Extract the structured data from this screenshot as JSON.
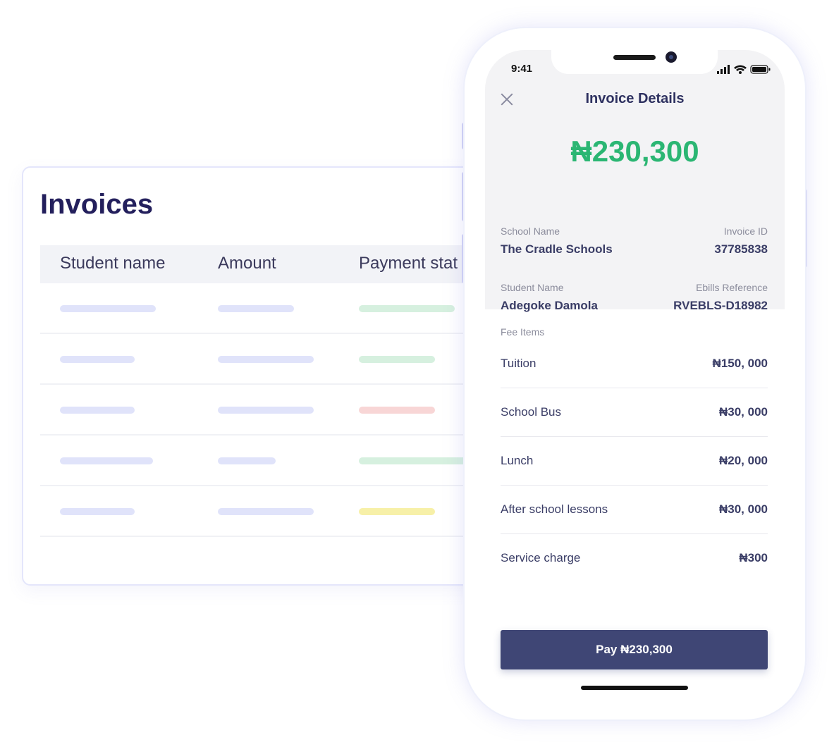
{
  "invoices": {
    "title": "Invoices",
    "columns": [
      "Student name",
      "Amount",
      "Payment stat"
    ],
    "row_status_colors": [
      "#d6f0df",
      "#d6f0df",
      "#f8d6d6",
      "#d6f0df",
      "#f7f0a8"
    ],
    "placeholder_color": "#e0e3fa"
  },
  "phone": {
    "status_time": "9:41",
    "title": "Invoice Details",
    "total": "₦230,300",
    "school_name_label": "School Name",
    "school_name": "The Cradle Schools",
    "invoice_id_label": "Invoice ID",
    "invoice_id": "37785838",
    "student_name_label": "Student Name",
    "student_name": "Adegoke Damola",
    "ebills_reference_label": "Ebills Reference",
    "ebills_reference": "RVEBLS-D18982",
    "fee_items_label": "Fee Items",
    "fee_items": [
      {
        "name": "Tuition",
        "amount": "₦150, 000"
      },
      {
        "name": "School Bus",
        "amount": "₦30, 000"
      },
      {
        "name": "Lunch",
        "amount": "₦20, 000"
      },
      {
        "name": "After school lessons",
        "amount": "₦30, 000"
      },
      {
        "name": "Service charge",
        "amount": "₦300"
      }
    ],
    "pay_label": "Pay ₦230,300",
    "colors": {
      "accent_green": "#2bb673",
      "button": "#3f4675",
      "text": "#3a3d66"
    }
  }
}
